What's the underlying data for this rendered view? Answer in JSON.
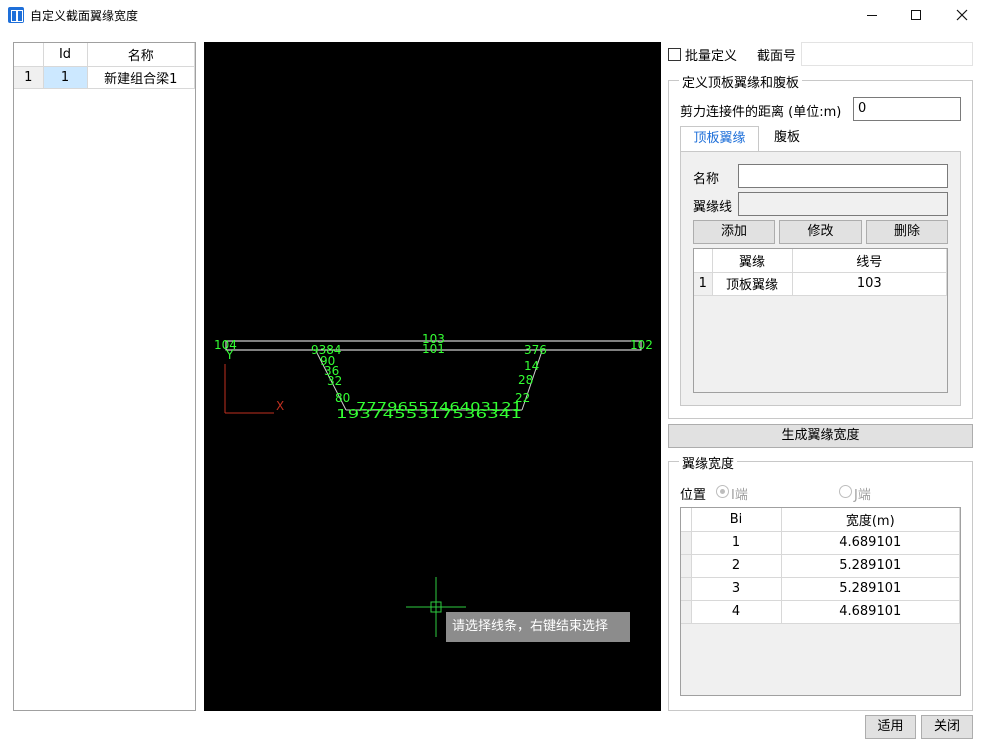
{
  "window": {
    "title": "自定义截面翼缘宽度",
    "minimize_icon": "minimize-icon",
    "maximize_icon": "maximize-icon",
    "close_icon": "close-icon"
  },
  "section_list": {
    "headers": [
      "",
      "Id",
      "名称"
    ],
    "rows": [
      {
        "row": "1",
        "id": "1",
        "name": "新建组合梁1"
      }
    ]
  },
  "canvas": {
    "background": "#000000",
    "line_color": "#ffffff",
    "label_color": "#33ff33",
    "axis_color": "#c03020",
    "labels": {
      "top_left": "104",
      "top_right": "102",
      "top_mid_upper": "103",
      "top_mid_lower": "101",
      "left_web_top": "9384",
      "left_web_mid1": "90",
      "left_web_mid2": "36",
      "left_web_mid3": "32",
      "right_web_top": "376",
      "right_web_mid1": "14",
      "right_web_mid2": "28",
      "left_corner": "80",
      "right_corner": "22",
      "bottom_upper": "7779655746403121",
      "bottom_lower": "1937455317536341",
      "axis_y": "Y",
      "axis_x": "X"
    },
    "tooltip": "请选择线条，右键结束选择"
  },
  "batch_define": {
    "label": "批量定义",
    "checked": false
  },
  "section_no": {
    "label": "截面号",
    "value": ""
  },
  "flange_web_group": {
    "title": "定义顶板翼缘和腹板",
    "shear_label": "剪力连接件的距离 (单位:m)",
    "shear_value": "0",
    "tabs": [
      "顶板翼缘",
      "腹板"
    ],
    "active_tab": "顶板翼缘",
    "name_label": "名称",
    "name_value": "",
    "line_label": "翼缘线",
    "line_value": "",
    "buttons": {
      "add": "添加",
      "modify": "修改",
      "delete": "删除"
    },
    "table": {
      "headers": [
        "",
        "翼缘",
        "线号"
      ],
      "rows": [
        {
          "row": "1",
          "flange": "顶板翼缘",
          "line": "103"
        }
      ]
    }
  },
  "generate_button": "生成翼缘宽度",
  "width_group": {
    "title": "翼缘宽度",
    "position_label": "位置",
    "radio_i": {
      "label": "I端",
      "checked": true,
      "disabled": true
    },
    "radio_j": {
      "label": "J端",
      "checked": false,
      "disabled": true
    },
    "table": {
      "headers": [
        "",
        "Bi",
        "宽度(m)"
      ],
      "rows": [
        {
          "bi": "1",
          "width": "4.689101"
        },
        {
          "bi": "2",
          "width": "5.289101"
        },
        {
          "bi": "3",
          "width": "5.289101"
        },
        {
          "bi": "4",
          "width": "4.689101"
        }
      ]
    }
  },
  "footer": {
    "apply": "适用",
    "close": "关闭"
  }
}
